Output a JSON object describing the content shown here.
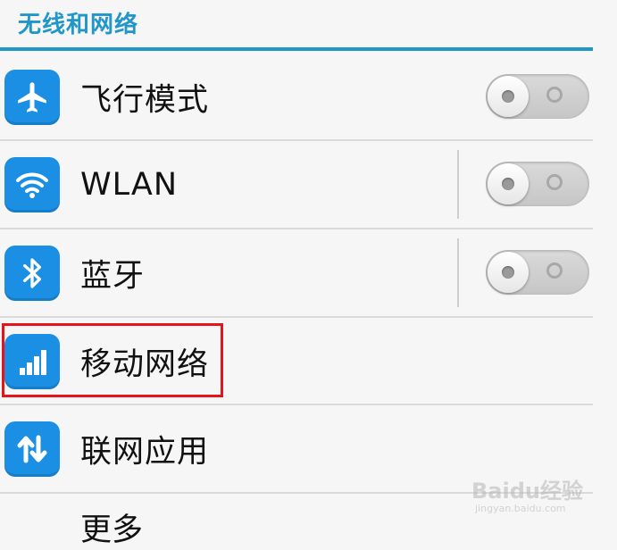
{
  "section": {
    "title": "无线和网络"
  },
  "rows": [
    {
      "label": "飞行模式",
      "icon": "airplane-icon",
      "toggle_state": "off"
    },
    {
      "label": "WLAN",
      "icon": "wifi-icon",
      "toggle_state": "off"
    },
    {
      "label": "蓝牙",
      "icon": "bluetooth-icon",
      "toggle_state": "off"
    },
    {
      "label": "移动网络",
      "icon": "signal-bars-icon",
      "highlighted": true
    },
    {
      "label": "联网应用",
      "icon": "up-down-arrows-icon"
    },
    {
      "label": "更多"
    }
  ],
  "watermark": {
    "main": "Baidu经验",
    "sub": "jingyan.baidu.com"
  },
  "colors": {
    "accent": "#2196c8",
    "icon_bg": "#1a8fe3",
    "highlight_border": "#e3141c",
    "background": "#f6f6f6"
  }
}
